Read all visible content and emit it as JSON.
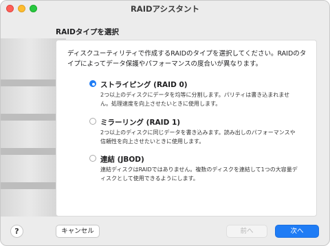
{
  "window": {
    "title": "RAIDアシスタント"
  },
  "section_title": "RAIDタイプを選択",
  "intro": "ディスクユーティリティで作成するRAIDのタイプを選択してください。RAIDのタイプによってデータ保護やパフォーマンスの度合いが異なります。",
  "options": [
    {
      "label": "ストライピング (RAID 0)",
      "description": "2つ以上のディスクにデータを均等に分割します。パリティは書き込まれません。処理速度を向上させたいときに使用します。",
      "selected": true
    },
    {
      "label": "ミラーリング (RAID 1)",
      "description": "2つ以上のディスクに同じデータを書き込みます。読み出しのパフォーマンスや信頼性を向上させたいときに使用します。",
      "selected": false
    },
    {
      "label": "連結 (JBOD)",
      "description": "連結ディスクはRAIDではありません。複数のディスクを連結して1つの大容量ディスクとして使用できるようにします。",
      "selected": false
    }
  ],
  "buttons": {
    "help": "?",
    "cancel": "キャンセル",
    "back": "前へ",
    "next": "次へ"
  },
  "colors": {
    "accent": "#1f7cf5"
  }
}
